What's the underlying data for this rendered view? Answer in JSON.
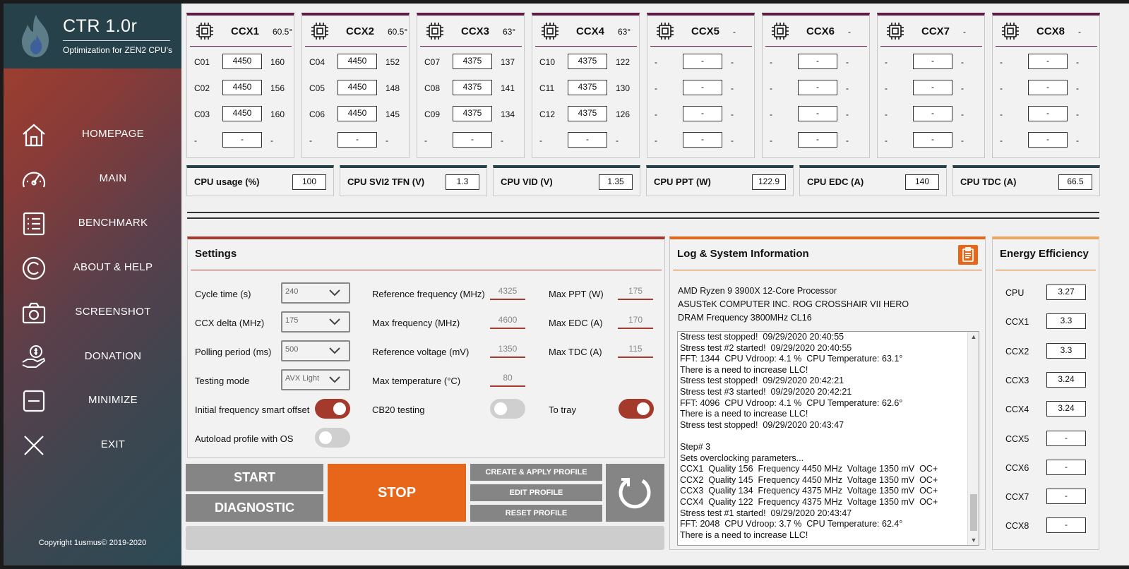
{
  "app": {
    "title": "CTR 1.0r",
    "subtitle": "Optimization for ZEN2 CPU's",
    "copyright": "Copyright 1usmus© 2019-2020"
  },
  "nav": [
    {
      "label": "HOMEPAGE",
      "icon": "home-icon"
    },
    {
      "label": "MAIN",
      "icon": "speedometer-icon"
    },
    {
      "label": "BENCHMARK",
      "icon": "list-icon"
    },
    {
      "label": "ABOUT & HELP",
      "icon": "copyright-icon"
    },
    {
      "label": "SCREENSHOT",
      "icon": "camera-icon"
    },
    {
      "label": "DONATION",
      "icon": "donation-hand-icon"
    },
    {
      "label": "MINIMIZE",
      "icon": "minimize-icon"
    },
    {
      "label": "EXIT",
      "icon": "close-icon"
    }
  ],
  "ccx": [
    {
      "name": "CCX1",
      "temp": "60.5°",
      "cores": [
        [
          "C01",
          "4450",
          "160"
        ],
        [
          "C02",
          "4450",
          "156"
        ],
        [
          "C03",
          "4450",
          "160"
        ],
        [
          "-",
          "-",
          "-"
        ]
      ]
    },
    {
      "name": "CCX2",
      "temp": "60.5°",
      "cores": [
        [
          "C04",
          "4450",
          "152"
        ],
        [
          "C05",
          "4450",
          "148"
        ],
        [
          "C06",
          "4450",
          "145"
        ],
        [
          "-",
          "-",
          "-"
        ]
      ]
    },
    {
      "name": "CCX3",
      "temp": "63°",
      "cores": [
        [
          "C07",
          "4375",
          "137"
        ],
        [
          "C08",
          "4375",
          "141"
        ],
        [
          "C09",
          "4375",
          "134"
        ],
        [
          "-",
          "-",
          "-"
        ]
      ]
    },
    {
      "name": "CCX4",
      "temp": "63°",
      "cores": [
        [
          "C10",
          "4375",
          "122"
        ],
        [
          "C11",
          "4375",
          "130"
        ],
        [
          "C12",
          "4375",
          "126"
        ],
        [
          "-",
          "-",
          "-"
        ]
      ]
    },
    {
      "name": "CCX5",
      "temp": "-",
      "cores": [
        [
          "-",
          "-",
          "-"
        ],
        [
          "-",
          "-",
          "-"
        ],
        [
          "-",
          "-",
          "-"
        ],
        [
          "-",
          "-",
          "-"
        ]
      ]
    },
    {
      "name": "CCX6",
      "temp": "-",
      "cores": [
        [
          "-",
          "-",
          "-"
        ],
        [
          "-",
          "-",
          "-"
        ],
        [
          "-",
          "-",
          "-"
        ],
        [
          "-",
          "-",
          "-"
        ]
      ]
    },
    {
      "name": "CCX7",
      "temp": "-",
      "cores": [
        [
          "-",
          "-",
          "-"
        ],
        [
          "-",
          "-",
          "-"
        ],
        [
          "-",
          "-",
          "-"
        ],
        [
          "-",
          "-",
          "-"
        ]
      ]
    },
    {
      "name": "CCX8",
      "temp": "-",
      "cores": [
        [
          "-",
          "-",
          "-"
        ],
        [
          "-",
          "-",
          "-"
        ],
        [
          "-",
          "-",
          "-"
        ],
        [
          "-",
          "-",
          "-"
        ]
      ]
    }
  ],
  "metrics": [
    {
      "label": "CPU usage (%)",
      "value": "100"
    },
    {
      "label": "CPU SVI2 TFN (V)",
      "value": "1.3"
    },
    {
      "label": "CPU VID (V)",
      "value": "1.35"
    },
    {
      "label": "CPU PPT (W)",
      "value": "122.9"
    },
    {
      "label": "CPU EDC (A)",
      "value": "140"
    },
    {
      "label": "CPU TDC (A)",
      "value": "66.5"
    }
  ],
  "settings": {
    "title": "Settings",
    "cycle_time_label": "Cycle time (s)",
    "cycle_time": "240",
    "ccx_delta_label": "CCX delta (MHz)",
    "ccx_delta": "175",
    "polling_label": "Polling period (ms)",
    "polling": "500",
    "testing_mode_label": "Testing mode",
    "testing_mode": "AVX Light",
    "smart_offset_label": "Initial frequency smart offset",
    "smart_offset_on": true,
    "autoload_label": "Autoload profile with OS",
    "autoload_on": false,
    "ref_freq_label": "Reference frequency (MHz)",
    "ref_freq": "4325",
    "max_freq_label": "Max frequency (MHz)",
    "max_freq": "4600",
    "ref_volt_label": "Reference voltage (mV)",
    "ref_volt": "1350",
    "max_temp_label": "Max temperature (°C)",
    "max_temp": "80",
    "cb20_label": "CB20 testing",
    "cb20_on": false,
    "max_ppt_label": "Max PPT (W)",
    "max_ppt": "175",
    "max_edc_label": "Max EDC (A)",
    "max_edc": "170",
    "max_tdc_label": "Max TDC (A)",
    "max_tdc": "115",
    "tray_label": "To tray",
    "tray_on": true
  },
  "buttons": {
    "start": "START",
    "diagnostic": "DIAGNOSTIC",
    "stop": "STOP",
    "create": "CREATE & APPLY PROFILE",
    "edit": "EDIT PROFILE",
    "reset": "RESET PROFILE"
  },
  "log": {
    "title": "Log & System Information",
    "cpu": "AMD Ryzen 9 3900X 12-Core Processor",
    "board": "ASUSTeK COMPUTER INC. ROG CROSSHAIR VII HERO",
    "dram": "DRAM Frequency 3800MHz CL16",
    "lines": [
      "Stress test stopped!  09/29/2020 20:40:55",
      "Stress test #2 started!  09/29/2020 20:40:55",
      "FFT: 1344  CPU Vdroop: 4.1 %  CPU Temperature: 63.1°",
      "There is a need to increase LLC!",
      "Stress test stopped!  09/29/2020 20:42:21",
      "Stress test #3 started!  09/29/2020 20:42:21",
      "FFT: 4096  CPU Vdroop: 4.1 %  CPU Temperature: 62.6°",
      "There is a need to increase LLC!",
      "Stress test stopped!  09/29/2020 20:43:47",
      "",
      "Step# 3",
      "Sets overclocking parameters...",
      "CCX1  Quality 156  Frequency 4450 MHz  Voltage 1350 mV  OC+",
      "CCX2  Quality 145  Frequency 4450 MHz  Voltage 1350 mV  OC+",
      "CCX3  Quality 134  Frequency 4375 MHz  Voltage 1350 mV  OC+",
      "CCX4  Quality 122  Frequency 4375 MHz  Voltage 1350 mV  OC+",
      "Stress test #1 started!  09/29/2020 20:43:47",
      "FFT: 2048  CPU Vdroop: 3.7 %  CPU Temperature: 62.4°",
      "There is a need to increase LLC!"
    ]
  },
  "energy": {
    "title": "Energy Efficiency",
    "rows": [
      [
        "CPU",
        "3.27"
      ],
      [
        "CCX1",
        "3.3"
      ],
      [
        "CCX2",
        "3.3"
      ],
      [
        "CCX3",
        "3.24"
      ],
      [
        "CCX4",
        "3.24"
      ],
      [
        "CCX5",
        "-"
      ],
      [
        "CCX6",
        "-"
      ],
      [
        "CCX7",
        "-"
      ],
      [
        "CCX8",
        "-"
      ]
    ]
  },
  "colors": {
    "accent_red": "#a33a2c",
    "accent_orange": "#e8661a",
    "ccx_purple": "#5b1d44",
    "metric_teal": "#27414a",
    "button_gray": "#858585"
  }
}
